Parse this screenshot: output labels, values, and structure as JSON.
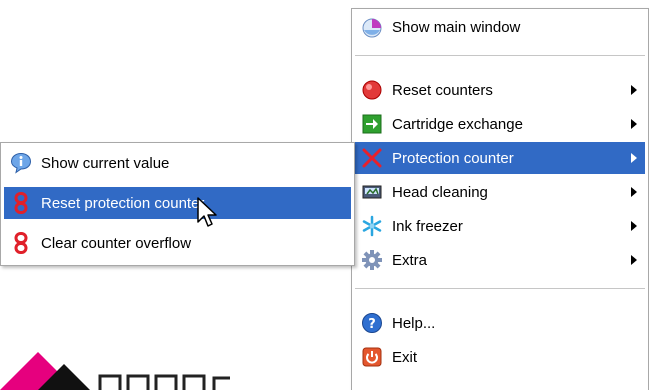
{
  "main_menu": {
    "show_main_window": "Show main window",
    "reset_counters": "Reset counters",
    "cartridge_exchange": "Cartridge exchange",
    "protection_counter": "Protection counter",
    "head_cleaning": "Head cleaning",
    "ink_freezer": "Ink freezer",
    "extra": "Extra",
    "help": "Help...",
    "exit": "Exit"
  },
  "sub_menu": {
    "show_current_value": "Show current value",
    "reset_protection_counter": "Reset protection counter",
    "clear_counter_overflow": "Clear counter overflow"
  },
  "colors": {
    "highlight": "#316ac5",
    "logo_magenta": "#e6007e"
  }
}
